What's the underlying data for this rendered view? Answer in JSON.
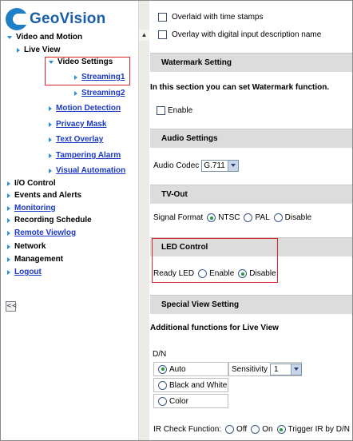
{
  "brand": {
    "name": "GeoVision"
  },
  "sidebar": {
    "collapse_label": "<<",
    "items": [
      {
        "label": "Video and Motion"
      },
      {
        "label": "Live View"
      },
      {
        "label": "Video Settings"
      },
      {
        "label": "Streaming1"
      },
      {
        "label": "Streaming2"
      },
      {
        "label": "Motion Detection"
      },
      {
        "label": "Privacy Mask"
      },
      {
        "label": "Text Overlay"
      },
      {
        "label": "Tampering Alarm"
      },
      {
        "label": "Visual Automation"
      },
      {
        "label": "I/O Control"
      },
      {
        "label": "Events and Alerts"
      },
      {
        "label": "Monitoring"
      },
      {
        "label": "Recording Schedule"
      },
      {
        "label": "Remote Viewlog"
      },
      {
        "label": "Network"
      },
      {
        "label": "Management"
      },
      {
        "label": "Logout"
      }
    ]
  },
  "content": {
    "overlay_time": "Overlaid with time stamps",
    "overlay_input": "Overlay with digital input description name",
    "watermark": {
      "title": "Watermark Setting",
      "desc": "In this section you can set Watermark function.",
      "enable": "Enable"
    },
    "audio": {
      "title": "Audio Settings",
      "codec_label": "Audio Codec",
      "codec_value": "G.711"
    },
    "tvout": {
      "title": "TV-Out",
      "signal_label": "Signal Format",
      "options": [
        "NTSC",
        "PAL",
        "Disable"
      ],
      "selected": "NTSC"
    },
    "led": {
      "title": "LED Control",
      "label": "Ready LED",
      "options": [
        "Enable",
        "Disable"
      ],
      "selected": "Disable"
    },
    "special": {
      "title": "Special View Setting",
      "desc": "Additional functions for Live View"
    },
    "dn": {
      "label": "D/N",
      "options": [
        "Auto",
        "Black and White",
        "Color"
      ],
      "selected": "Auto",
      "sensitivity_label": "Sensitivity",
      "sensitivity_value": "1"
    },
    "ir": {
      "label": "IR Check Function:",
      "options": [
        "Off",
        "On",
        "Trigger IR by D/N"
      ],
      "selected": "Trigger IR by D/N"
    }
  },
  "colors": {
    "accent": "#1a39c4",
    "highlight_box": "#d9262c",
    "section_bg": "#dcdcdc",
    "logo_blue": "#1d7fc8"
  }
}
